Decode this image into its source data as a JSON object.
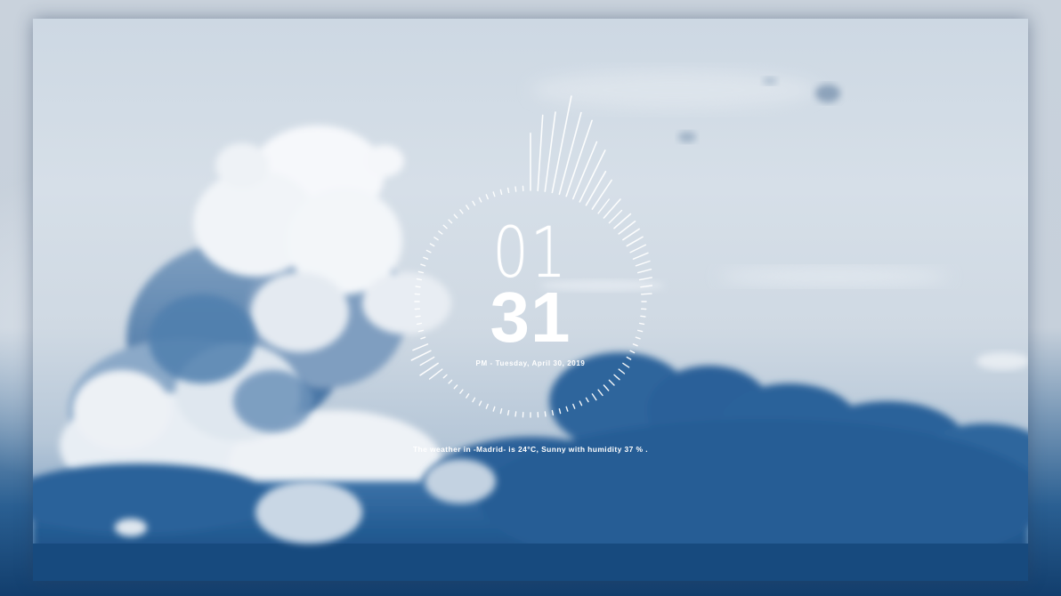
{
  "clock": {
    "hours": "01",
    "minutes": "31",
    "date_line": "PM - Tuesday, April 30, 2019"
  },
  "weather": {
    "text": "The weather in -Madrid- is 24°C, Sunny with humidity 37 % ."
  },
  "colors": {
    "text": "#ffffff",
    "sky": "#d3dde7",
    "cloud_dark": "#245c93",
    "cloud_light": "#f3f6f9"
  }
}
